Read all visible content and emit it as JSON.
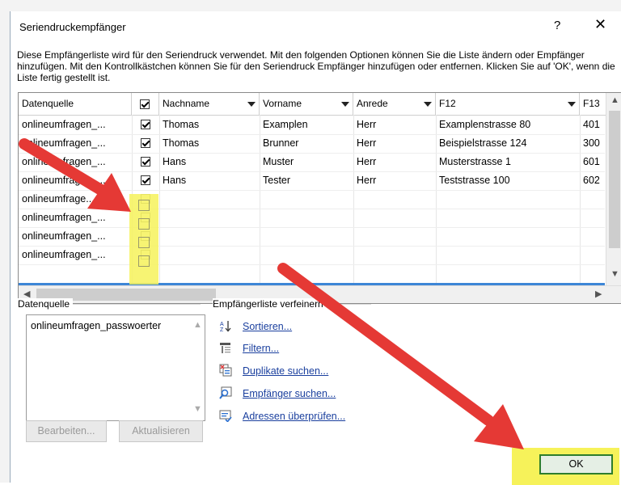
{
  "window": {
    "title": "Seriendruckempfänger",
    "help": "?",
    "close": "✕"
  },
  "description": "Diese Empfängerliste wird für den Seriendruck verwendet. Mit den folgenden Optionen können Sie die Liste ändern oder Empfänger hinzufügen. Mit den Kontrollkästchen können Sie für den Seriendruck Empfänger hinzufügen oder entfernen. Klicken Sie auf 'OK', wenn die Liste fertig gestellt ist.",
  "table": {
    "headers": [
      "Datenquelle",
      "",
      "Nachname",
      "Vorname",
      "Anrede",
      "F12",
      "F13"
    ],
    "rows": [
      {
        "source": "onlineumfragen_...",
        "checked": true,
        "nachname": "Thomas",
        "vorname": "Examplen",
        "anrede": "Herr",
        "f12": "Examplenstrasse 80",
        "f13": "401"
      },
      {
        "source": "onlineumfragen_...",
        "checked": true,
        "nachname": "Thomas",
        "vorname": "Brunner",
        "anrede": "Herr",
        "f12": "Beispielstrasse 124",
        "f13": "300"
      },
      {
        "source": "onlineumfragen_...",
        "checked": true,
        "nachname": "Hans",
        "vorname": "Muster",
        "anrede": "Herr",
        "f12": "Musterstrasse 1",
        "f13": "601"
      },
      {
        "source": "onlineumfragen_...",
        "checked": true,
        "nachname": "Hans",
        "vorname": "Tester",
        "anrede": "Herr",
        "f12": "Teststrasse 100",
        "f13": "602"
      },
      {
        "source": "onlineumfrage...",
        "checked": false,
        "nachname": "",
        "vorname": "",
        "anrede": "",
        "f12": "",
        "f13": ""
      },
      {
        "source": "onlineumfragen_...",
        "checked": false,
        "nachname": "",
        "vorname": "",
        "anrede": "",
        "f12": "",
        "f13": ""
      },
      {
        "source": "onlineumfragen_...",
        "checked": false,
        "nachname": "",
        "vorname": "",
        "anrede": "",
        "f12": "",
        "f13": ""
      },
      {
        "source": "onlineumfragen_...",
        "checked": false,
        "nachname": "",
        "vorname": "",
        "anrede": "",
        "f12": "",
        "f13": ""
      }
    ]
  },
  "datasource": {
    "label": "Datenquelle",
    "item": "onlineumfragen_passwoerter",
    "edit": "Bearbeiten...",
    "refresh": "Aktualisieren"
  },
  "refine": {
    "label": "Empfängerliste verfeinern",
    "links": [
      "Sortieren...",
      "Filtern...",
      "Duplikate suchen...",
      "Empfänger suchen...",
      "Adressen überprüfen..."
    ]
  },
  "ok": "OK",
  "colors": {
    "highlight": "#f6f25a",
    "arrow": "#e53935",
    "link": "#1a3f9e",
    "ok_border": "#2d7d2d"
  }
}
